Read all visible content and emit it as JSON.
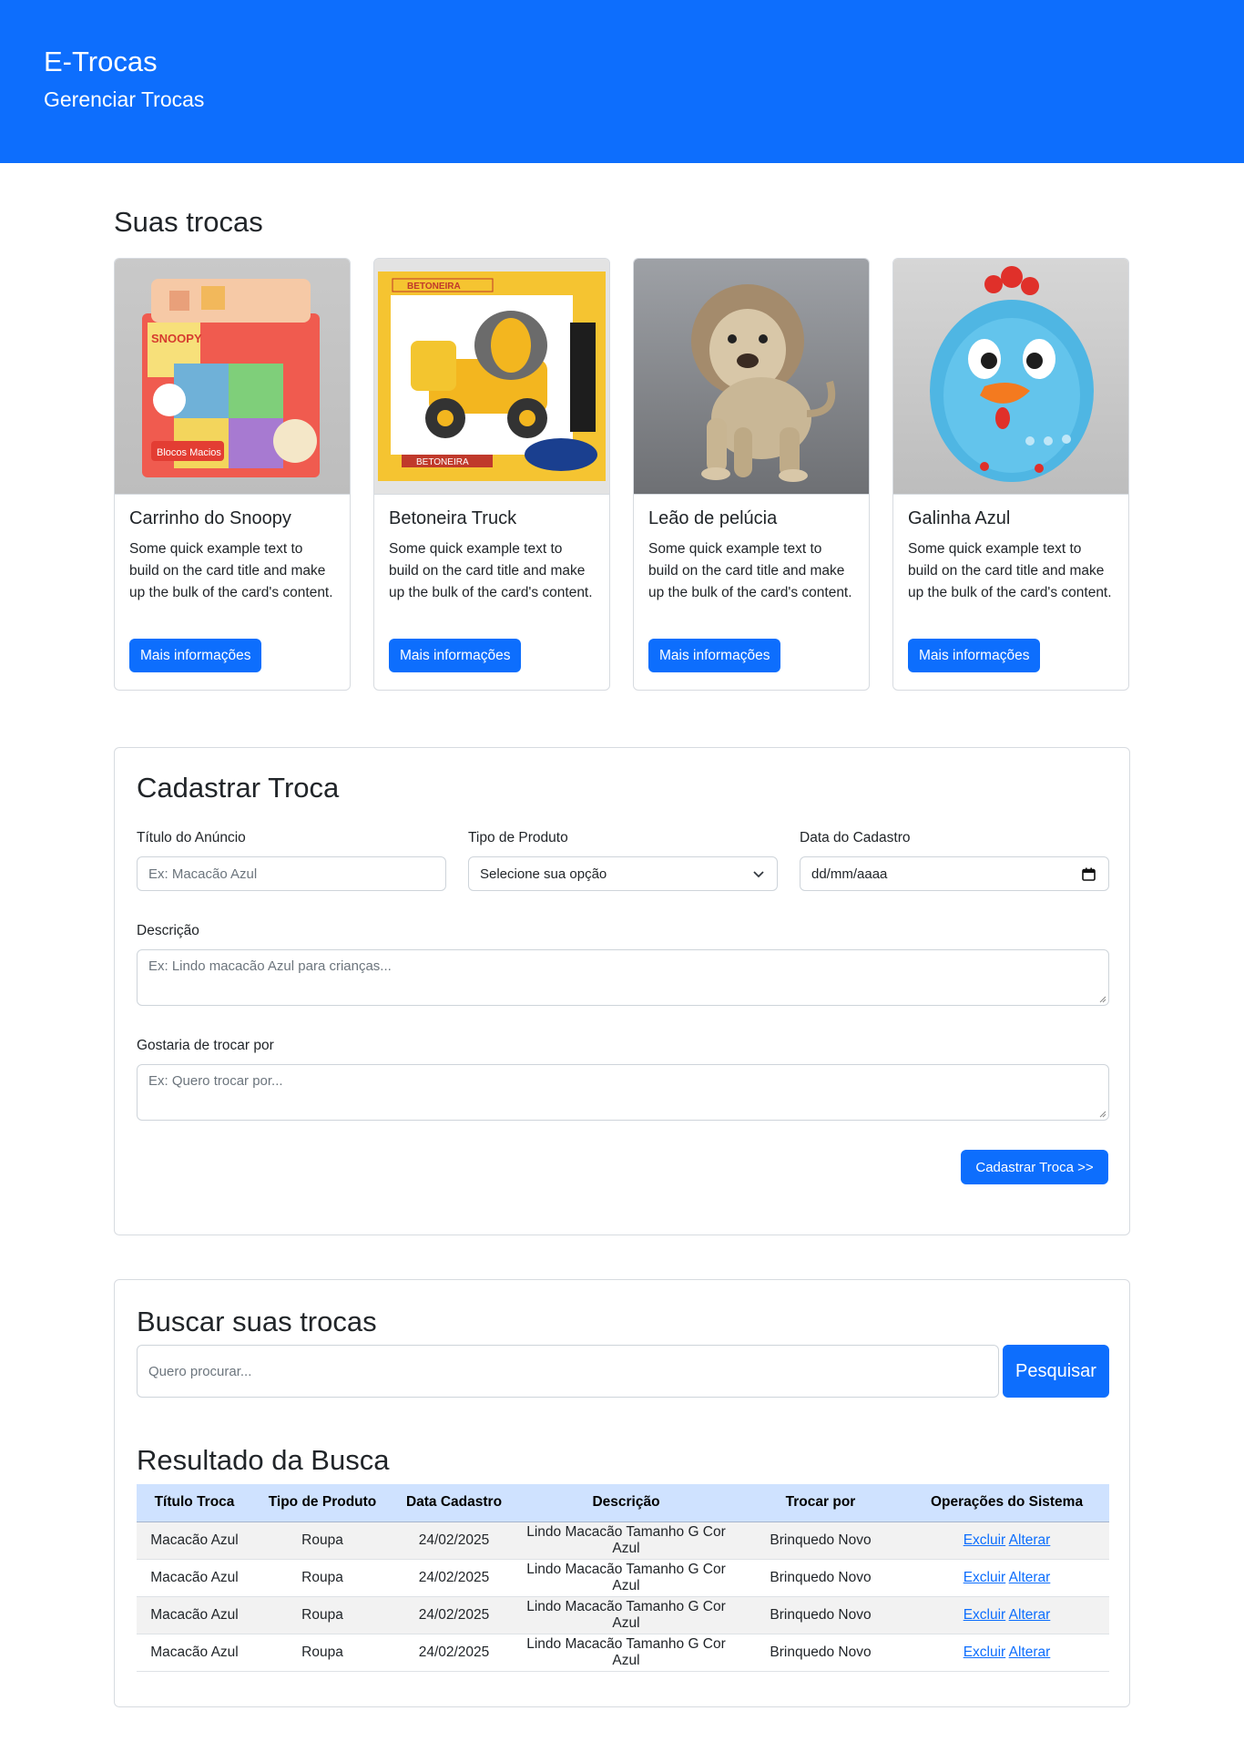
{
  "header": {
    "brand": "E-Trocas",
    "subtitle": "Gerenciar Trocas"
  },
  "cards_section": {
    "title": "Suas trocas",
    "cards": [
      {
        "title": "Carrinho do Snoopy",
        "text": "Some quick example text to build on the card title and make up the bulk of the card's content.",
        "button": "Mais informações",
        "image": "snoopy-blocks-toy-image"
      },
      {
        "title": "Betoneira Truck",
        "text": "Some quick example text to build on the card title and make up the bulk of the card's content.",
        "button": "Mais informações",
        "image": "yellow-truck-toy-image"
      },
      {
        "title": "Leão de pelúcia",
        "text": "Some quick example text to build on the card title and make up the bulk of the card's content.",
        "button": "Mais informações",
        "image": "plush-lion-image"
      },
      {
        "title": "Galinha Azul",
        "text": "Some quick example text to build on the card title and make up the bulk of the card's content.",
        "button": "Mais informações",
        "image": "blue-chicken-toy-image"
      }
    ]
  },
  "form": {
    "title": "Cadastrar Troca",
    "titulo_label": "Título do Anúncio",
    "titulo_placeholder": "Ex: Macacão Azul",
    "tipo_label": "Tipo de Produto",
    "tipo_value": "Selecione sua opção",
    "data_label": "Data do Cadastro",
    "data_value": "dd/mm/aaaa",
    "descricao_label": "Descrição",
    "descricao_placeholder": "Ex: Lindo macacão Azul para crianças...",
    "trocar_label": "Gostaria de trocar por",
    "trocar_placeholder": "Ex: Quero trocar por...",
    "submit": "Cadastrar Troca >>"
  },
  "search": {
    "title": "Buscar suas trocas",
    "placeholder": "Quero procurar...",
    "button": "Pesquisar",
    "results_title": "Resultado da Busca",
    "columns": [
      "Título Troca",
      "Tipo de Produto",
      "Data Cadastro",
      "Descrição",
      "Trocar por",
      "Operações do Sistema"
    ],
    "rows": [
      {
        "titulo": "Macacão Azul",
        "tipo": "Roupa",
        "data": "24/02/2025",
        "descricao": "Lindo Macacão Tamanho G Cor Azul",
        "trocar": "Brinquedo Novo",
        "excluir": "Excluir",
        "alterar": "Alterar"
      },
      {
        "titulo": "Macacão Azul",
        "tipo": "Roupa",
        "data": "24/02/2025",
        "descricao": "Lindo Macacão Tamanho G Cor Azul",
        "trocar": "Brinquedo Novo",
        "excluir": "Excluir",
        "alterar": "Alterar"
      },
      {
        "titulo": "Macacão Azul",
        "tipo": "Roupa",
        "data": "24/02/2025",
        "descricao": "Lindo Macacão Tamanho G Cor Azul",
        "trocar": "Brinquedo Novo",
        "excluir": "Excluir",
        "alterar": "Alterar"
      },
      {
        "titulo": "Macacão Azul",
        "tipo": "Roupa",
        "data": "24/02/2025",
        "descricao": "Lindo Macacão Tamanho G Cor Azul",
        "trocar": "Brinquedo Novo",
        "excluir": "Excluir",
        "alterar": "Alterar"
      }
    ]
  },
  "colors": {
    "primary": "#0d6efd",
    "table_header": "#cfe2ff",
    "row_stripe": "#f2f2f2"
  }
}
